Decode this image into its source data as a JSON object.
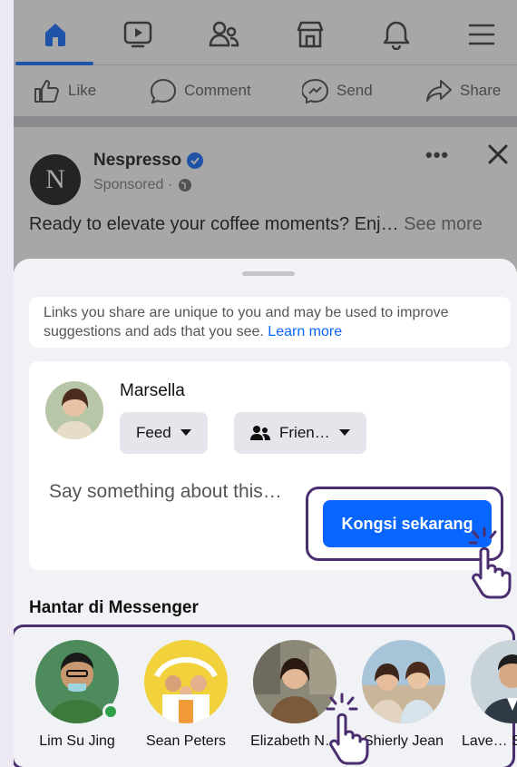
{
  "nav": {
    "icons": [
      "home-icon",
      "video-icon",
      "friends-icon",
      "marketplace-icon",
      "bell-icon",
      "menu-icon"
    ],
    "accent": "#0866ff"
  },
  "actions": {
    "like": "Like",
    "comment": "Comment",
    "send": "Send",
    "share": "Share"
  },
  "post": {
    "logo_letter": "N",
    "page_name": "Nespresso",
    "sponsored": "Sponsored ·",
    "text": "Ready to elevate your coffee moments? Enj…",
    "see_more": "See more"
  },
  "sheet": {
    "notice": "Links you share are unique to you and may be used to improve suggestions and ads that you see.",
    "learn_more": "Learn more",
    "user_name": "Marsella",
    "feed_label": "Feed",
    "audience_label": "Frien…",
    "placeholder": "Say something about this…",
    "share_now": "Kongsi sekarang",
    "messenger_heading": "Hantar di Messenger"
  },
  "contacts": [
    {
      "name": "Lim Su Jing",
      "online": true
    },
    {
      "name": "Sean Peters",
      "online": false
    },
    {
      "name": "Elizabeth N…",
      "online": false
    },
    {
      "name": "Shierly Jean",
      "online": false
    },
    {
      "name": "Lave… Steve…",
      "online": false
    }
  ]
}
